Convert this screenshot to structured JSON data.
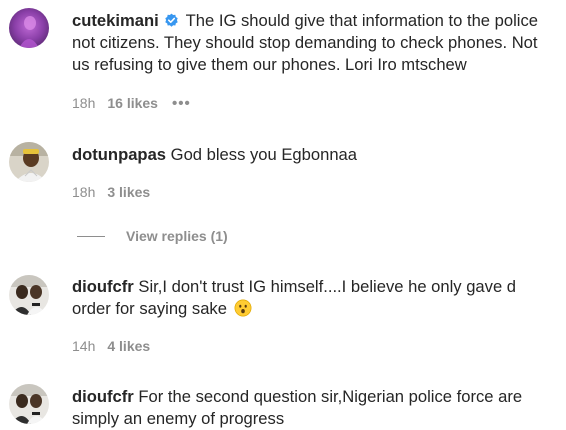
{
  "comments": [
    {
      "username": "cutekimani",
      "verified": true,
      "text": "The IG should give that information to the police not citizens. They should stop demanding to check phones. Not us refusing to give them our phones. Lori Iro mtschew",
      "time": "18h",
      "likes": "16 likes",
      "more": "•••",
      "avatar_icon": "avatar-purple-photo-icon"
    },
    {
      "username": "dotunpapas",
      "verified": false,
      "text": "God bless you Egbonnaa",
      "time": "18h",
      "likes": "3 likes",
      "avatar_icon": "avatar-man-photo-icon",
      "view_replies": "View replies (1)"
    },
    {
      "username": "dioufcfr",
      "verified": false,
      "text": "Sir,I don't trust IG himself....I believe he only gave d order for saying sake",
      "emoji": "hushed-face-emoji-icon",
      "time": "14h",
      "likes": "4 likes",
      "avatar_icon": "avatar-group-photo-icon"
    },
    {
      "username": "dioufcfr",
      "verified": false,
      "text": "For the second question sir,Nigerian police force are simply an enemy of progress",
      "avatar_icon": "avatar-group-photo-icon"
    }
  ],
  "colors": {
    "text": "#262626",
    "meta": "#8e8e8e",
    "verified": "#3897f0",
    "emoji": "#ffcc33"
  }
}
